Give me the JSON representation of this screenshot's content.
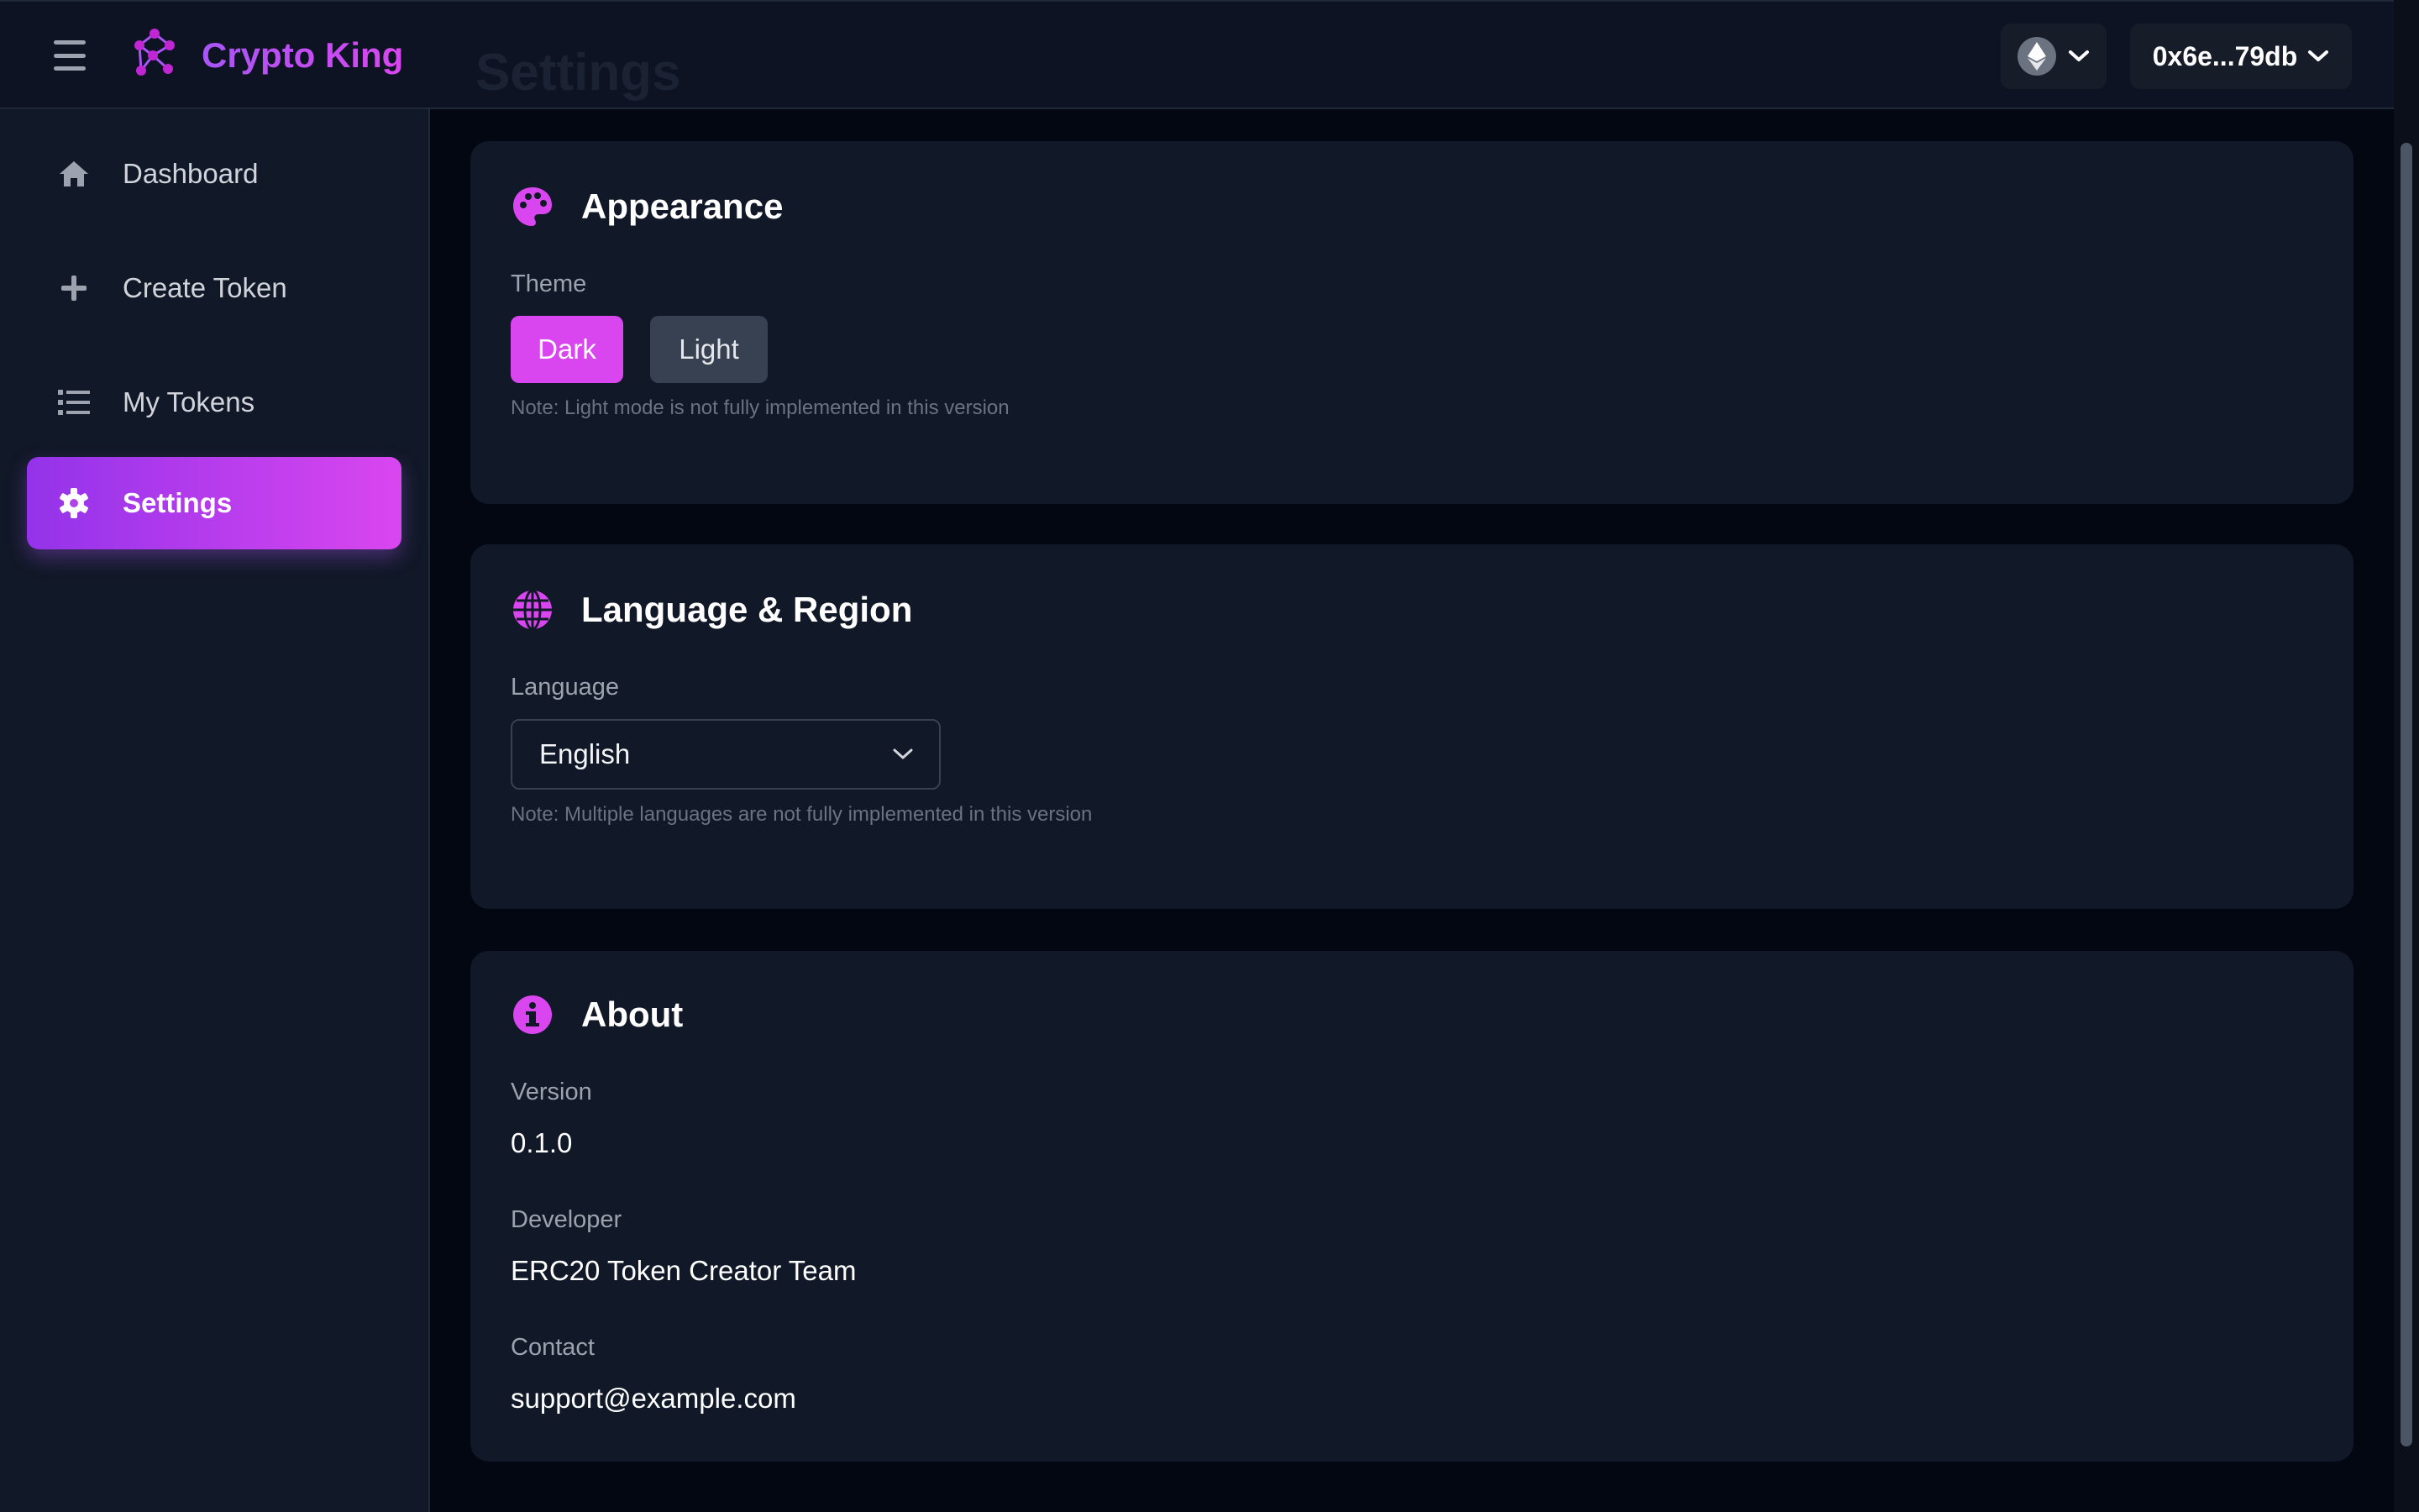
{
  "header": {
    "brand": "Crypto King",
    "page_title": "Settings",
    "network_icon": "ethereum-icon",
    "wallet_address": "0x6e...79db"
  },
  "sidebar": {
    "items": [
      {
        "label": "Dashboard",
        "icon": "home-icon"
      },
      {
        "label": "Create Token",
        "icon": "plus-icon"
      },
      {
        "label": "My Tokens",
        "icon": "list-icon"
      },
      {
        "label": "Settings",
        "icon": "gear-icon",
        "active": true
      }
    ]
  },
  "appearance": {
    "title": "Appearance",
    "theme_label": "Theme",
    "dark_label": "Dark",
    "light_label": "Light",
    "selected_theme": "Dark",
    "note": "Note: Light mode is not fully implemented in this version"
  },
  "language": {
    "title": "Language & Region",
    "language_label": "Language",
    "selected_language": "English",
    "note": "Note: Multiple languages are not fully implemented in this version"
  },
  "about": {
    "title": "About",
    "version_label": "Version",
    "version_value": "0.1.0",
    "developer_label": "Developer",
    "developer_value": "ERC20 Token Creator Team",
    "contact_label": "Contact",
    "contact_value": "support@example.com"
  },
  "colors": {
    "accent": "#d946ef",
    "accent_purple": "#9333ea",
    "background": "#030712",
    "card": "#111827"
  }
}
